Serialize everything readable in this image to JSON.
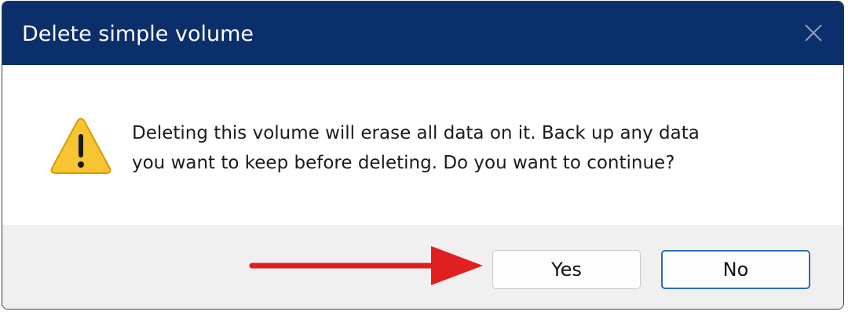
{
  "dialog": {
    "title": "Delete simple volume",
    "close_icon": "close-icon",
    "message_lines": [
      "Deleting this volume will erase all data on it. Back up any data",
      "you want to keep before deleting. Do you want to continue?"
    ],
    "icon": "warning-icon",
    "buttons": {
      "yes_label": "Yes",
      "no_label": "No"
    }
  },
  "colors": {
    "titlebar": "#0b2f6b",
    "warning_fill": "#f7c531",
    "annotation_arrow": "#e02020",
    "focused_button_border": "#2e6db1"
  }
}
